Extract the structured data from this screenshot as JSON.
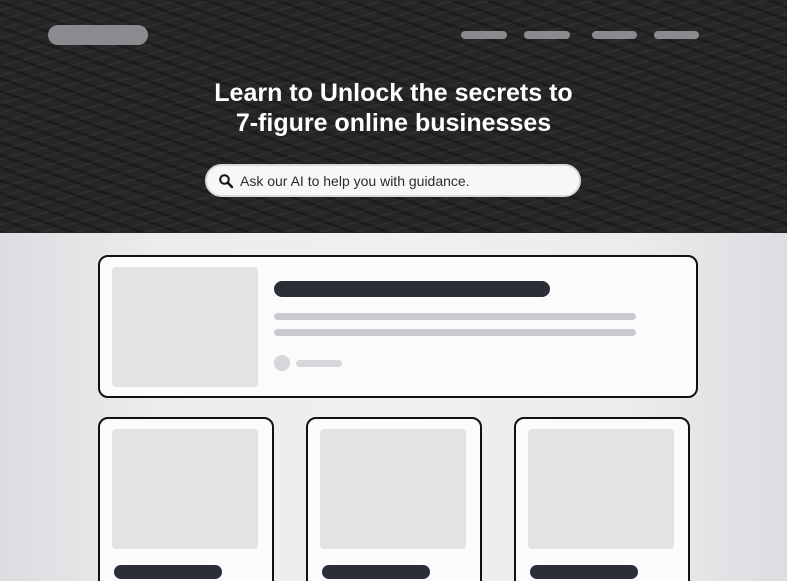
{
  "hero": {
    "headline_line1": "Learn to Unlock the secrets to",
    "headline_line2": "7-figure online businesses",
    "background_color": "#262626"
  },
  "search": {
    "placeholder": "Ask our AI to help you with guidance.",
    "value": "",
    "icon": "search-icon"
  },
  "nav": {
    "item_count_placeholders": 4
  },
  "cards": {
    "featured": {
      "placeholder": true
    },
    "grid": [
      {
        "placeholder": true
      },
      {
        "placeholder": true
      },
      {
        "placeholder": true
      }
    ]
  },
  "colors": {
    "skeleton_dark": "#2b2e36",
    "skeleton_light": "#c9cbd0",
    "card_border": "#111111"
  }
}
